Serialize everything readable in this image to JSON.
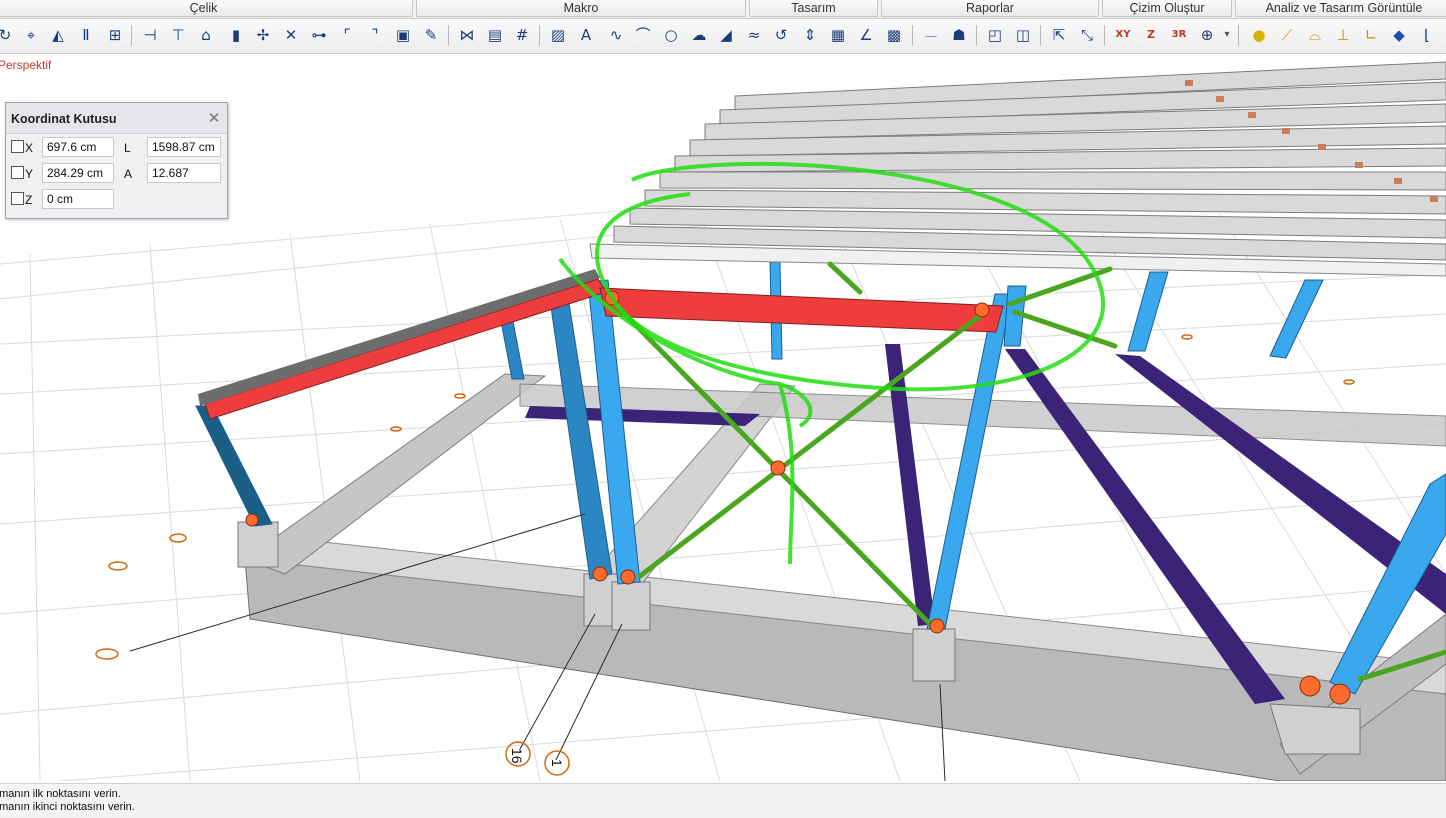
{
  "menu": {
    "tabs": [
      {
        "label": "Çelik"
      },
      {
        "label": "Makro"
      },
      {
        "label": "Tasarım"
      },
      {
        "label": "Raporlar"
      },
      {
        "label": "Çizim Oluştur"
      },
      {
        "label": "Analiz ve Tasarım Görüntüle"
      }
    ]
  },
  "toolbar": {
    "icons": [
      "undo-icon",
      "snap-target-icon",
      "mirror-icon",
      "column-icon",
      "grid-snap-icon",
      "beam-icon",
      "beam-end-icon",
      "roof-icon",
      "column-section-icon",
      "node-icon",
      "cross-icon",
      "split-icon",
      "corner-icon",
      "corner-trim-icon",
      "rectangle-icon",
      "brush-icon",
      "frame-icon",
      "panel-icon",
      "grid-icon",
      "image-icon",
      "text-icon",
      "polyline-icon",
      "arc-icon",
      "circle-icon",
      "cloud-icon",
      "slope-icon",
      "wave-icon",
      "rotate-icon",
      "dimension-icon",
      "table-icon",
      "measure-icon",
      "cost-icon",
      "level-icon",
      "annotation-icon",
      "view-3d-icon",
      "view-split-icon",
      "move-icon",
      "stretch-icon",
      "xy-view-icon",
      "z-view-icon",
      "3d-render-icon",
      "zoom-fit-icon",
      "toolbar-overflow-icon",
      "light-icon",
      "truss-icon",
      "hat-section-icon",
      "marker-icon",
      "angle-section-icon",
      "flag-icon",
      "graph-icon"
    ]
  },
  "viewport": {
    "view_label": "Perspektif"
  },
  "coordinate_box": {
    "title": "Koordinat Kutusu",
    "close_icon": "close-icon",
    "x_label": "X",
    "x_value": "697.6 cm",
    "y_label": "Y",
    "y_value": "284.29 cm",
    "z_label": "Z",
    "z_value": "0 cm",
    "l_label": "L",
    "l_value": "1598.87 cm",
    "a_label": "A",
    "a_value": "12.687"
  },
  "grid_bubbles": {
    "left_label": "16",
    "right_label": "1"
  },
  "command_line": {
    "lines": [
      "emanın ilk noktasını verin.",
      "emanın ikinci noktasını verin."
    ]
  },
  "colors": {
    "highlight_beam": "#ee3d3d",
    "column": "#39a8ee",
    "bracing": "#5cb822",
    "tie_beam": "#3b2378",
    "foundation": "#b9b9b9",
    "markup": "#22dd11",
    "connection": "#ff6a2e"
  }
}
